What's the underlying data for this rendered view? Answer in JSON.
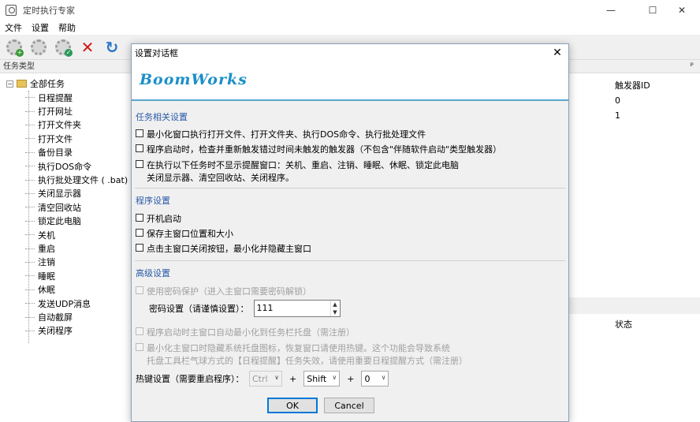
{
  "window": {
    "title": "定时执行专家",
    "minimize": "—",
    "maximize": "☐",
    "close": "✕"
  },
  "menu": [
    "文件",
    "设置",
    "帮助"
  ],
  "left_panel": {
    "header": "任务类型",
    "root": "全部任务",
    "items": [
      "日程提醒",
      "打开网址",
      "打开文件夹",
      "打开文件",
      "备份目录",
      "执行DOS命令",
      "执行批处理文件 ( .bat)",
      "关闭显示器",
      "清空回收站",
      "锁定此电脑",
      "关机",
      "重启",
      "注销",
      "睡眠",
      "休眠",
      "发送UDP消息",
      "自动截屏",
      "关闭程序"
    ]
  },
  "right_panel": {
    "pin": "ᵖ",
    "column_header": "触发器ID",
    "values": [
      "0",
      "1"
    ],
    "bottom_header": "状态"
  },
  "dialog": {
    "title": "设置对话框",
    "close": "✕",
    "logo": "BoomWorks",
    "section1": {
      "title": "任务相关设置",
      "options": [
        "最小化窗口执行打开文件、打开文件夹、执行DOS命令、执行批处理文件",
        "程序启动时，检查并重新触发错过时间未触发的触发器（不包含\"伴随软件启动\"类型触发器）",
        "在执行以下任务时不显示提醒窗口：关机、重启、注销、睡眠、休眠、锁定此电脑",
        "关闭显示器、清空回收站、关闭程序。"
      ]
    },
    "section2": {
      "title": "程序设置",
      "options": [
        "开机启动",
        "保存主窗口位置和大小",
        "点击主窗口关闭按钮，最小化并隐藏主窗口"
      ]
    },
    "section3": {
      "title": "高级设置",
      "password_protect": "使用密码保护（进入主窗口需要密码解锁）",
      "password_label": "密码设置（请谨慎设置）：",
      "password_value": "111",
      "minimize_to_tray": "程序启动时主窗口自动最小化到任务栏托盘（需注册）",
      "hide_tray_line1": "最小化主窗口时隐藏系统托盘图标，恢复窗口请使用热键。这个功能会导致系统",
      "hide_tray_line2": "托盘工具栏气球方式的【日程提醒】任务失效，请使用重要日程提醒方式（需注册）",
      "hotkey_label": "热键设置（需要重启程序）：",
      "hotkey_ctrl": "Ctrl",
      "hotkey_shift": "Shift",
      "hotkey_key": "0",
      "plus": "+"
    },
    "ok": "OK",
    "cancel": "Cancel"
  }
}
